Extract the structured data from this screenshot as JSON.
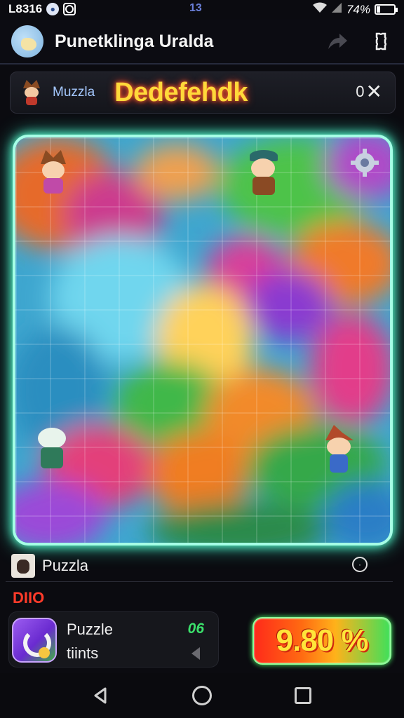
{
  "status_bar": {
    "time": "L8316",
    "center": "13",
    "battery": "74%",
    "battery_level": 0.2
  },
  "app_bar": {
    "title": "Punetklinga Uralda",
    "share_icon": "share-arrow-icon",
    "settings_icon": "puzzle-piece-settings-icon"
  },
  "header": {
    "label": "Muzzla",
    "level_title": "Dedefehdk",
    "close_prefix": "0",
    "close_icon": "close-x-icon"
  },
  "puzzle_row": {
    "label": "Puzzla",
    "info_icon": "info-circle-icon"
  },
  "section_label": "DIIO",
  "card": {
    "line1": "Puzzle",
    "line2": "tiints",
    "count": "06"
  },
  "progress": {
    "text": "9.80 %"
  },
  "nav": {
    "back_icon": "back-triangle-icon",
    "home_icon": "home-circle-icon",
    "recent_icon": "recent-square-icon"
  },
  "colors": {
    "board_glow": "#a6ffe6",
    "title_yellow": "#ffd93a",
    "accent_green": "#3be06b",
    "accent_red": "#ff3b2a"
  }
}
